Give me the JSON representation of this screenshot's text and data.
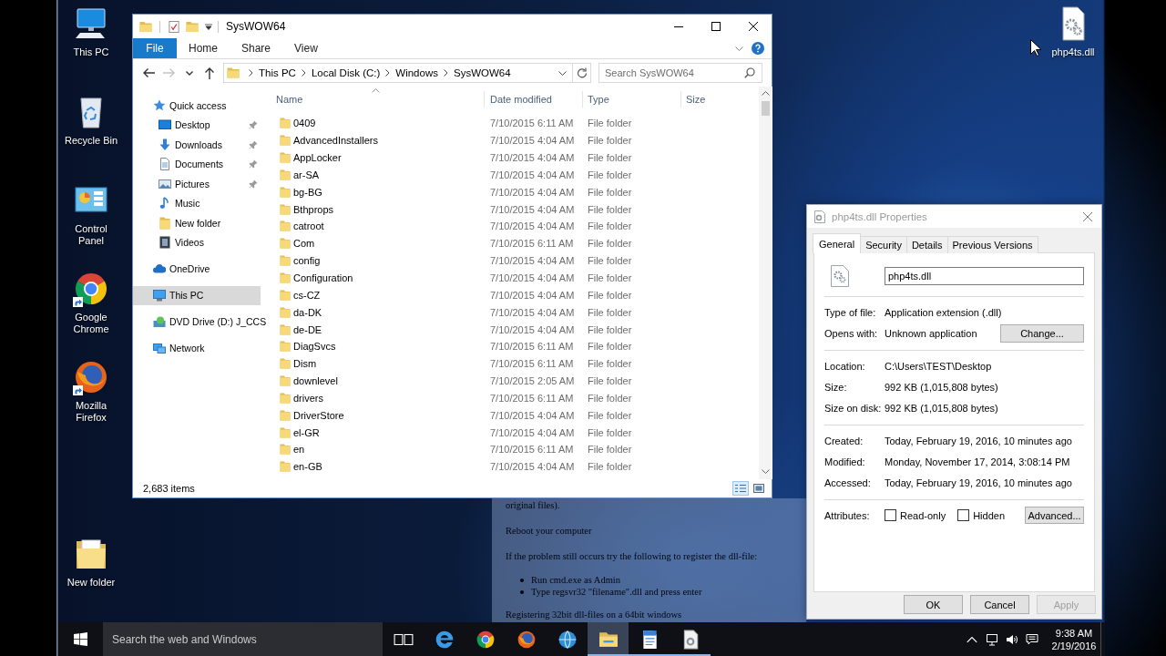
{
  "desktop": {
    "icons": [
      {
        "label": "This PC",
        "kind": "pc",
        "shortcut": false
      },
      {
        "label": "Recycle Bin",
        "kind": "recycle_bin",
        "shortcut": false
      },
      {
        "label": "Control Panel",
        "kind": "control_panel",
        "shortcut": false
      },
      {
        "label": "Google Chrome",
        "kind": "chrome",
        "shortcut": true
      },
      {
        "label": "Mozilla Firefox",
        "kind": "firefox",
        "shortcut": true
      },
      {
        "label": "New folder",
        "kind": "folder",
        "shortcut": false
      }
    ],
    "right_icons": [
      {
        "label": "php4ts.dll",
        "kind": "dll",
        "shortcut": false
      }
    ]
  },
  "explorer": {
    "title": "SysWOW64",
    "file_tab": "File",
    "ribbon_tabs": [
      "Home",
      "Share",
      "View"
    ],
    "nav_buttons": [
      {
        "kind": "back",
        "disabled": false
      },
      {
        "kind": "forward",
        "disabled": true
      },
      {
        "kind": "recent",
        "disabled": false
      },
      {
        "kind": "up",
        "disabled": false
      }
    ],
    "path": [
      "This PC",
      "Local Disk (C:)",
      "Windows",
      "SysWOW64"
    ],
    "search": {
      "placeholder": "Search SysWOW64"
    },
    "nav": [
      {
        "label": "Quick access",
        "kind": "star",
        "selected": false,
        "children": [
          {
            "label": "Desktop",
            "kind": "desktop",
            "pinned": true,
            "selected": false
          },
          {
            "label": "Downloads",
            "kind": "downloads",
            "pinned": true,
            "selected": false
          },
          {
            "label": "Documents",
            "kind": "documents",
            "pinned": true,
            "selected": false
          },
          {
            "label": "Pictures",
            "kind": "pictures",
            "pinned": true,
            "selected": false
          },
          {
            "label": "Music",
            "kind": "music",
            "pinned": false,
            "selected": false
          },
          {
            "label": "New folder",
            "kind": "folder",
            "pinned": false,
            "selected": false
          },
          {
            "label": "Videos",
            "kind": "videos",
            "pinned": false,
            "selected": false
          }
        ]
      },
      {
        "label": "OneDrive",
        "kind": "cloud",
        "selected": false
      },
      {
        "label": "This PC",
        "kind": "pc",
        "selected": true
      },
      {
        "label": "DVD Drive (D:) J_CCS",
        "kind": "dvd",
        "selected": false
      },
      {
        "label": "Network",
        "kind": "network",
        "selected": false
      }
    ],
    "columns": [
      "Name",
      "Date modified",
      "Type",
      "Size"
    ],
    "rows": [
      {
        "name": "0409",
        "date": "7/10/2015 6:11 AM",
        "type": "File folder"
      },
      {
        "name": "AdvancedInstallers",
        "date": "7/10/2015 4:04 AM",
        "type": "File folder"
      },
      {
        "name": "AppLocker",
        "date": "7/10/2015 4:04 AM",
        "type": "File folder"
      },
      {
        "name": "ar-SA",
        "date": "7/10/2015 4:04 AM",
        "type": "File folder"
      },
      {
        "name": "bg-BG",
        "date": "7/10/2015 4:04 AM",
        "type": "File folder"
      },
      {
        "name": "Bthprops",
        "date": "7/10/2015 4:04 AM",
        "type": "File folder"
      },
      {
        "name": "catroot",
        "date": "7/10/2015 4:04 AM",
        "type": "File folder"
      },
      {
        "name": "Com",
        "date": "7/10/2015 6:11 AM",
        "type": "File folder"
      },
      {
        "name": "config",
        "date": "7/10/2015 4:04 AM",
        "type": "File folder"
      },
      {
        "name": "Configuration",
        "date": "7/10/2015 4:04 AM",
        "type": "File folder"
      },
      {
        "name": "cs-CZ",
        "date": "7/10/2015 4:04 AM",
        "type": "File folder"
      },
      {
        "name": "da-DK",
        "date": "7/10/2015 4:04 AM",
        "type": "File folder"
      },
      {
        "name": "de-DE",
        "date": "7/10/2015 4:04 AM",
        "type": "File folder"
      },
      {
        "name": "DiagSvcs",
        "date": "7/10/2015 6:11 AM",
        "type": "File folder"
      },
      {
        "name": "Dism",
        "date": "7/10/2015 6:11 AM",
        "type": "File folder"
      },
      {
        "name": "downlevel",
        "date": "7/10/2015 2:05 AM",
        "type": "File folder"
      },
      {
        "name": "drivers",
        "date": "7/10/2015 6:11 AM",
        "type": "File folder"
      },
      {
        "name": "DriverStore",
        "date": "7/10/2015 4:04 AM",
        "type": "File folder"
      },
      {
        "name": "el-GR",
        "date": "7/10/2015 4:04 AM",
        "type": "File folder"
      },
      {
        "name": "en",
        "date": "7/10/2015 6:11 AM",
        "type": "File folder"
      },
      {
        "name": "en-GB",
        "date": "7/10/2015 4:04 AM",
        "type": "File folder"
      }
    ],
    "status": "2,683 items",
    "views": [
      {
        "kind": "details",
        "selected": true
      },
      {
        "kind": "large_icons",
        "selected": false
      }
    ]
  },
  "properties": {
    "title": "php4ts.dll Properties",
    "active": false,
    "tabs": [
      {
        "label": "General",
        "selected": true
      },
      {
        "label": "Security",
        "selected": false
      },
      {
        "label": "Details",
        "selected": false
      },
      {
        "label": "Previous Versions",
        "selected": false
      }
    ],
    "file_name": "php4ts.dll",
    "sections": [
      [
        {
          "label": "Type of file:",
          "value": "Application extension (.dll)"
        },
        {
          "label": "Opens with:",
          "value": "Unknown application",
          "button": "Change..."
        }
      ],
      [
        {
          "label": "Location:",
          "value": "C:\\Users\\TEST\\Desktop"
        },
        {
          "label": "Size:",
          "value": "992 KB (1,015,808 bytes)"
        },
        {
          "label": "Size on disk:",
          "value": "992 KB (1,015,808 bytes)"
        }
      ],
      [
        {
          "label": "Created:",
          "value": "Today, February 19, 2016, 10 minutes ago"
        },
        {
          "label": "Modified:",
          "value": "Monday, November 17, 2014, 3:08:14 PM"
        },
        {
          "label": "Accessed:",
          "value": "Today, February 19, 2016, 10 minutes ago"
        }
      ]
    ],
    "attributes": {
      "label": "Attributes:",
      "options": [
        {
          "label": "Read-only",
          "checked": false
        },
        {
          "label": "Hidden",
          "checked": false
        }
      ],
      "button": "Advanced..."
    },
    "buttons": [
      {
        "label": "OK",
        "disabled": false
      },
      {
        "label": "Cancel",
        "disabled": false
      },
      {
        "label": "Apply",
        "disabled": true
      }
    ]
  },
  "background_document": {
    "lines": [
      {
        "kind": "para",
        "text": "original files)."
      },
      {
        "kind": "para",
        "text": "Reboot your computer"
      },
      {
        "kind": "para",
        "text": "If the problem still occurs try the following to register the dll-file:"
      },
      {
        "kind": "bullet",
        "text": "Run cmd.exe as Admin"
      },
      {
        "kind": "bullet",
        "text": "Type regsvr32 \"filename\".dll and press enter"
      },
      {
        "kind": "para",
        "text": "Registering 32bit dll-files on a 64bit windows"
      }
    ]
  },
  "taskbar": {
    "search": {
      "placeholder": "Search the web and Windows"
    },
    "apps": [
      {
        "kind": "task_view",
        "running": false,
        "selected": false
      },
      {
        "kind": "edge",
        "running": false,
        "selected": false
      },
      {
        "kind": "chrome",
        "running": false,
        "selected": false
      },
      {
        "kind": "firefox",
        "running": false,
        "selected": false
      },
      {
        "kind": "browser",
        "running": false,
        "selected": false
      },
      {
        "kind": "explorer",
        "running": true,
        "selected": true
      },
      {
        "kind": "wordpad",
        "running": true,
        "selected": false
      },
      {
        "kind": "document",
        "running": true,
        "selected": false
      }
    ],
    "time": "9:38 AM",
    "date": "2/19/2016"
  }
}
